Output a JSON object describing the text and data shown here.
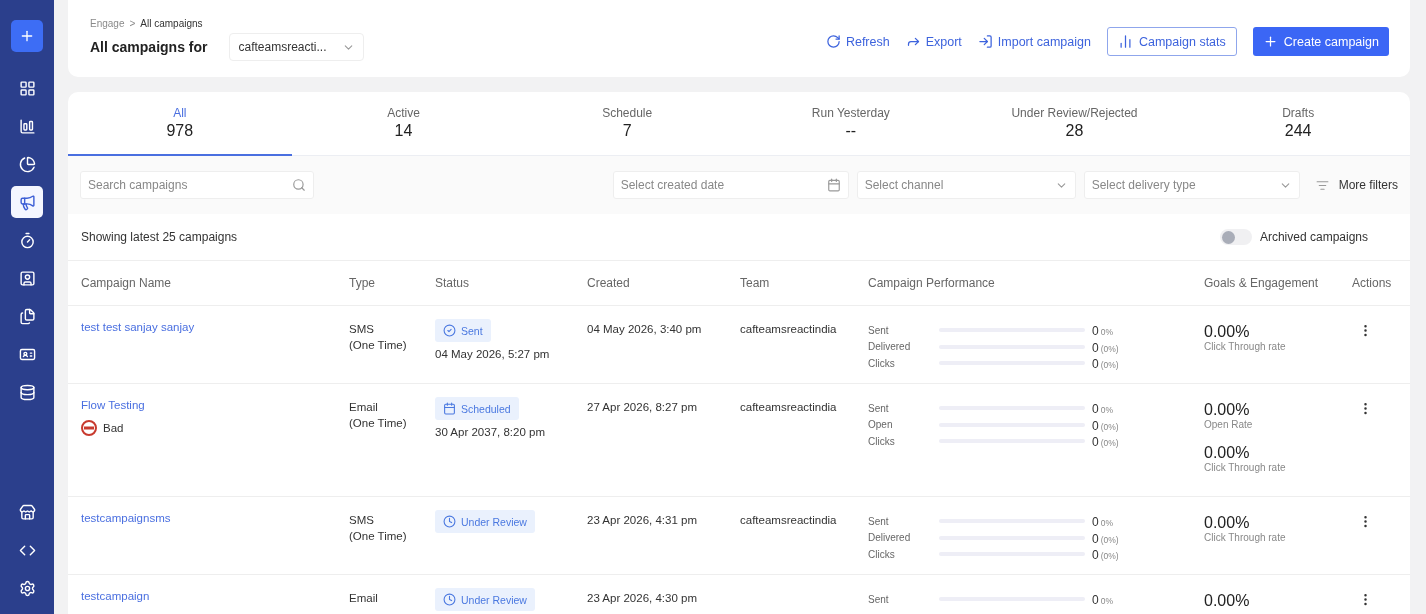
{
  "sidebar": {
    "items": [
      {
        "kind": "add",
        "selected": false
      },
      {
        "kind": "dashboard",
        "selected": false
      },
      {
        "kind": "reports",
        "selected": false
      },
      {
        "kind": "segments",
        "selected": false
      },
      {
        "kind": "campaigns",
        "selected": true
      },
      {
        "kind": "timer",
        "selected": false
      },
      {
        "kind": "contacts",
        "selected": false
      },
      {
        "kind": "documents",
        "selected": false
      },
      {
        "kind": "cards",
        "selected": false
      },
      {
        "kind": "database",
        "selected": false
      }
    ],
    "bottom_items": [
      {
        "kind": "store",
        "selected": false
      },
      {
        "kind": "code",
        "selected": false
      },
      {
        "kind": "settings",
        "selected": false
      }
    ]
  },
  "header": {
    "breadcrumb": [
      {
        "label": "Engage",
        "current": false
      },
      {
        "label": "All campaigns",
        "current": true
      }
    ],
    "breadcrumb_separator": ">",
    "title": "All campaigns for",
    "account_select": "cafteamsreacti...",
    "actions": [
      {
        "kind": "refresh",
        "label": "Refresh"
      },
      {
        "kind": "export",
        "label": "Export"
      },
      {
        "kind": "import",
        "label": "Import campaign"
      }
    ],
    "stats_button": "Campaign stats",
    "create_button": "Create campaign"
  },
  "tabs": [
    {
      "label": "All",
      "count": "978",
      "selected": true
    },
    {
      "label": "Active",
      "count": "14",
      "selected": false
    },
    {
      "label": "Schedule",
      "count": "7",
      "selected": false
    },
    {
      "label": "Run Yesterday",
      "count": "--",
      "selected": false
    },
    {
      "label": "Under Review/Rejected",
      "count": "28",
      "selected": false
    },
    {
      "label": "Drafts",
      "count": "244",
      "selected": false
    }
  ],
  "filters": {
    "search_placeholder": "Search campaigns",
    "date_placeholder": "Select created date",
    "channel_placeholder": "Select channel",
    "delivery_placeholder": "Select delivery type",
    "more_filters": "More filters"
  },
  "summary": {
    "text": "Showing latest 25 campaigns",
    "archived_label": "Archived campaigns",
    "archived_on": false
  },
  "table": {
    "columns": [
      "Campaign Name",
      "Type",
      "Status",
      "Created",
      "Team",
      "Campaign Performance",
      "Goals & Engagement",
      "Actions"
    ],
    "rows": [
      {
        "name": "test test sanjay sanjay",
        "type": [
          "SMS",
          "(One Time)"
        ],
        "status": {
          "kind": "sent",
          "label": "Sent"
        },
        "status_time": "04 May 2026, 5:27 pm",
        "created": "04 May 2026, 3:40 pm",
        "team": "cafteamsreactindia",
        "metrics": [
          {
            "label": "Sent",
            "count": "0",
            "percent": "0%"
          },
          {
            "label": "Delivered",
            "count": "0",
            "percent": "(0%)"
          },
          {
            "label": "Clicks",
            "count": "0",
            "percent": "(0%)"
          }
        ],
        "goals": [
          {
            "value": "0.00%",
            "label": "Click Through rate"
          }
        ]
      },
      {
        "name": "Flow Testing",
        "tag": "Bad",
        "type": [
          "Email",
          "(One Time)"
        ],
        "status": {
          "kind": "scheduled",
          "label": "Scheduled"
        },
        "status_time": "30 Apr 2037, 8:20 pm",
        "created": "27 Apr 2026, 8:27 pm",
        "team": "cafteamsreactindia",
        "metrics": [
          {
            "label": "Sent",
            "count": "0",
            "percent": "0%"
          },
          {
            "label": "Open",
            "count": "0",
            "percent": "(0%)"
          },
          {
            "label": "Clicks",
            "count": "0",
            "percent": "(0%)"
          }
        ],
        "goals": [
          {
            "value": "0.00%",
            "label": "Open Rate"
          },
          {
            "value": "0.00%",
            "label": "Click Through rate"
          }
        ]
      },
      {
        "name": "testcampaignsms",
        "type": [
          "SMS",
          "(One Time)"
        ],
        "status": {
          "kind": "review",
          "label": "Under Review"
        },
        "created": "23 Apr 2026, 4:31 pm",
        "team": "cafteamsreactindia",
        "metrics": [
          {
            "label": "Sent",
            "count": "0",
            "percent": "0%"
          },
          {
            "label": "Delivered",
            "count": "0",
            "percent": "(0%)"
          },
          {
            "label": "Clicks",
            "count": "0",
            "percent": "(0%)"
          }
        ],
        "goals": [
          {
            "value": "0.00%",
            "label": "Click Through rate"
          }
        ]
      },
      {
        "name": "testcampaign",
        "type": [
          "Email"
        ],
        "status": {
          "kind": "review",
          "label": "Under Review"
        },
        "created": "23 Apr 2026, 4:30 pm",
        "metrics": [
          {
            "label": "Sent",
            "count": "0",
            "percent": "0%"
          }
        ],
        "goals": [
          {
            "value": "0.00%"
          }
        ]
      }
    ]
  }
}
